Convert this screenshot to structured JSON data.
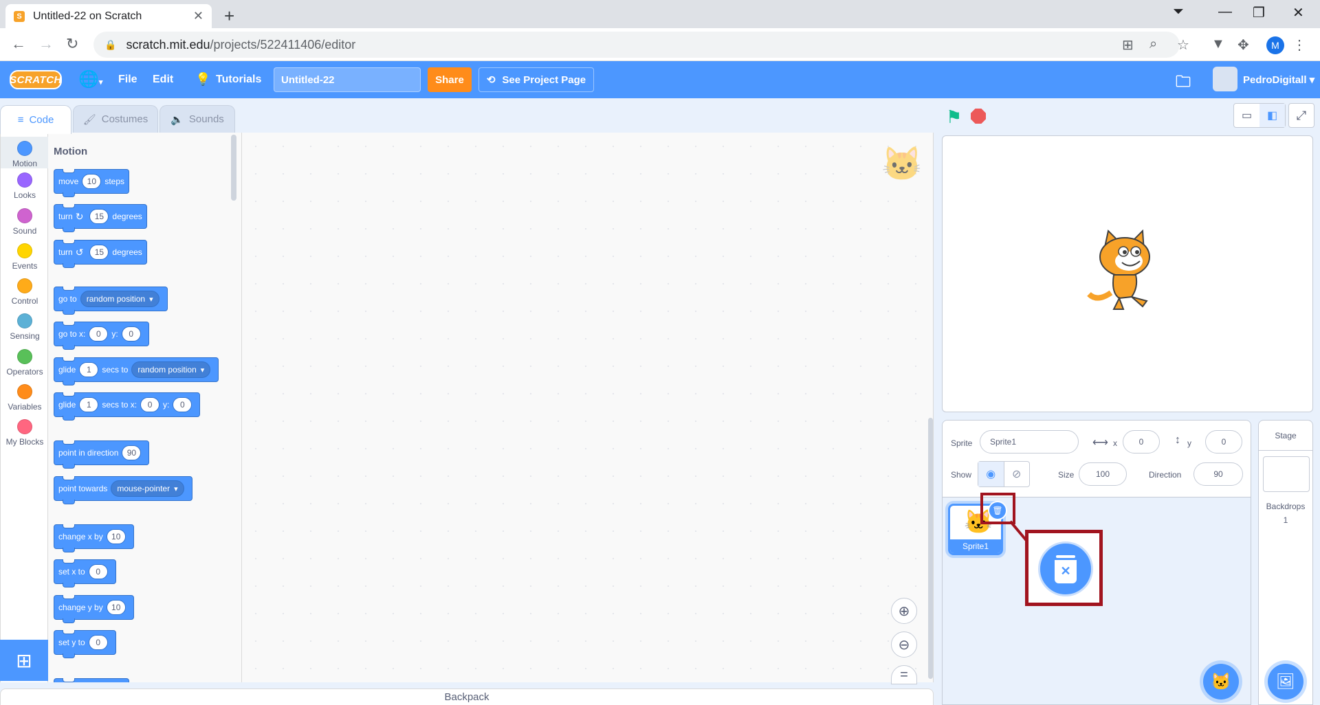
{
  "browser": {
    "tab_title": "Untitled-22 on Scratch",
    "url_host": "scratch.mit.edu",
    "url_path": "/projects/522411406/editor",
    "profile_initial": "M"
  },
  "menubar": {
    "logo": "SCRATCH",
    "file": "File",
    "edit": "Edit",
    "tutorials": "Tutorials",
    "project_title": "Untitled-22",
    "share": "Share",
    "see_project": "See Project Page",
    "username": "PedroDigitall"
  },
  "tabs": {
    "code": "Code",
    "costumes": "Costumes",
    "sounds": "Sounds"
  },
  "categories": [
    {
      "label": "Motion",
      "color": "#4c97ff"
    },
    {
      "label": "Looks",
      "color": "#9966ff"
    },
    {
      "label": "Sound",
      "color": "#cf63cf"
    },
    {
      "label": "Events",
      "color": "#ffd500"
    },
    {
      "label": "Control",
      "color": "#ffab19"
    },
    {
      "label": "Sensing",
      "color": "#5cb1d6"
    },
    {
      "label": "Operators",
      "color": "#59c059"
    },
    {
      "label": "Variables",
      "color": "#ff8c1a"
    },
    {
      "label": "My Blocks",
      "color": "#ff6680"
    }
  ],
  "palette": {
    "heading": "Motion",
    "move": {
      "a": "move",
      "n": "10",
      "b": "steps"
    },
    "turn_cw": {
      "a": "turn",
      "n": "15",
      "b": "degrees"
    },
    "turn_ccw": {
      "a": "turn",
      "n": "15",
      "b": "degrees"
    },
    "goto": {
      "a": "go to",
      "d": "random position"
    },
    "gotoxy": {
      "a": "go to x:",
      "x": "0",
      "b": "y:",
      "y": "0"
    },
    "glide_to": {
      "a": "glide",
      "n": "1",
      "b": "secs to",
      "d": "random position"
    },
    "glide_xy": {
      "a": "glide",
      "n": "1",
      "b": "secs to x:",
      "x": "0",
      "c": "y:",
      "y": "0"
    },
    "point_dir": {
      "a": "point in direction",
      "n": "90"
    },
    "point_towards": {
      "a": "point towards",
      "d": "mouse-pointer"
    },
    "change_x": {
      "a": "change x by",
      "n": "10"
    },
    "set_x": {
      "a": "set x to",
      "n": "0"
    },
    "change_y": {
      "a": "change y by",
      "n": "10"
    },
    "set_y": {
      "a": "set y to",
      "n": "0"
    }
  },
  "backpack": "Backpack",
  "sprite_info": {
    "sprite_label": "Sprite",
    "sprite_name": "Sprite1",
    "x_label": "x",
    "x": "0",
    "y_label": "y",
    "y": "0",
    "show_label": "Show",
    "size_label": "Size",
    "size": "100",
    "direction_label": "Direction",
    "direction": "90"
  },
  "sprites": [
    {
      "name": "Sprite1"
    }
  ],
  "stage_pane": {
    "title": "Stage",
    "backdrops_label": "Backdrops",
    "backdrops_count": "1"
  }
}
